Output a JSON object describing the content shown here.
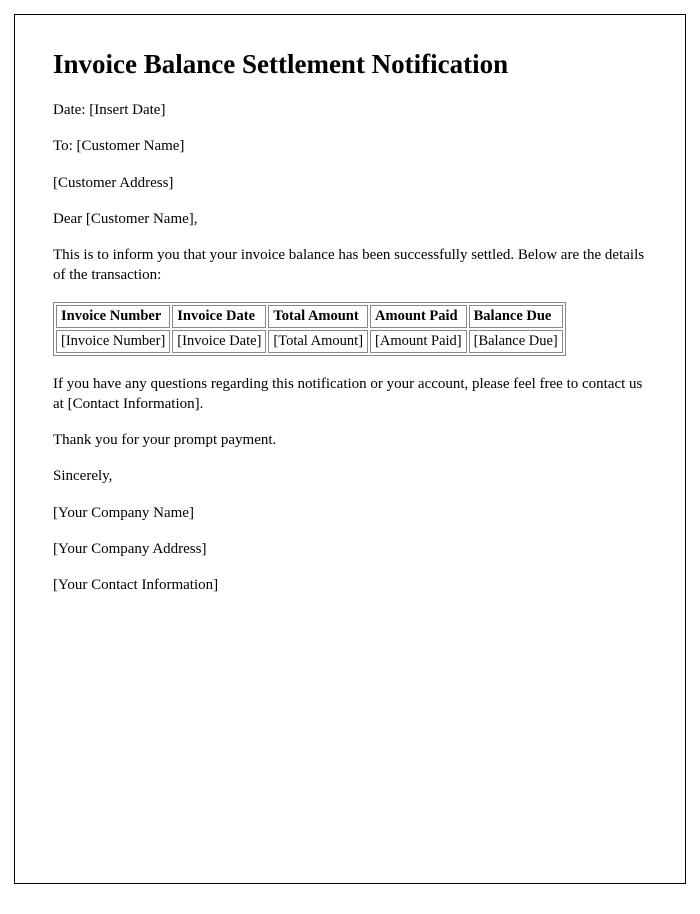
{
  "title": "Invoice Balance Settlement Notification",
  "date_line": "Date: [Insert Date]",
  "to_line": "To: [Customer Name]",
  "customer_address": "[Customer Address]",
  "salutation": "Dear [Customer Name],",
  "intro_paragraph": "This is to inform you that your invoice balance has been successfully settled. Below are the details of the transaction:",
  "table": {
    "headers": [
      "Invoice Number",
      "Invoice Date",
      "Total Amount",
      "Amount Paid",
      "Balance Due"
    ],
    "row": [
      "[Invoice Number]",
      "[Invoice Date]",
      "[Total Amount]",
      "[Amount Paid]",
      "[Balance Due]"
    ]
  },
  "questions_paragraph": "If you have any questions regarding this notification or your account, please feel free to contact us at [Contact Information].",
  "thanks_line": "Thank you for your prompt payment.",
  "closing": "Sincerely,",
  "company_name": "[Your Company Name]",
  "company_address": "[Your Company Address]",
  "company_contact": "[Your Contact Information]"
}
